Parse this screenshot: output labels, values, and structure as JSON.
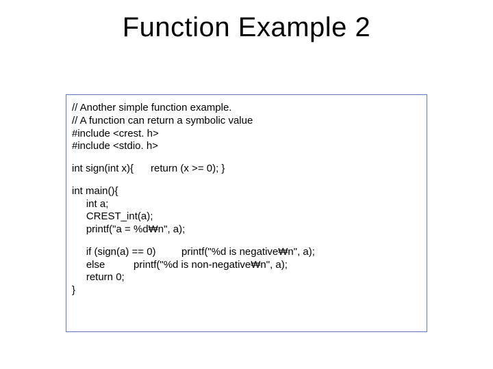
{
  "title": "Function Example 2",
  "code": {
    "block1": {
      "l1": "// Another simple function example.",
      "l2": "// A function can return a symbolic value",
      "l3": "#include <crest. h>",
      "l4": "#include <stdio. h>"
    },
    "block2": {
      "l1": "int sign(int x){      return (x >= 0); }"
    },
    "block3": {
      "l1": "int main(){",
      "l2": "     int a;",
      "l3": "     CREST_int(a);",
      "l4": "     printf(\"a = %d₩n\", a);"
    },
    "block4": {
      "l1": "     if (sign(a) == 0)         printf(\"%d is negative₩n\", a);",
      "l2": "     else          printf(\"%d is non-negative₩n\", a);",
      "l3": "     return 0;",
      "l4": "}"
    }
  }
}
